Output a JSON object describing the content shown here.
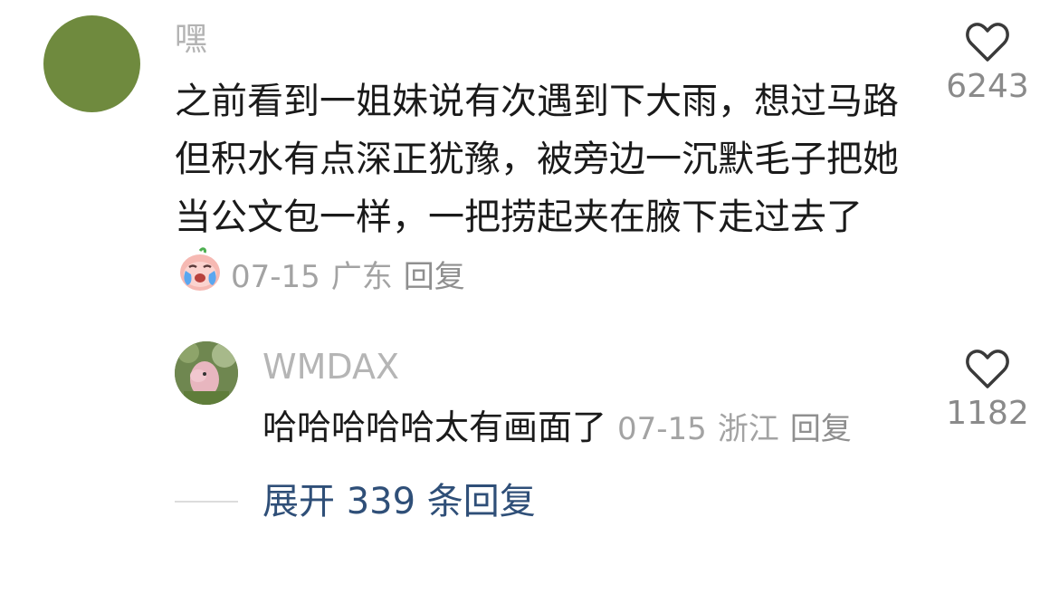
{
  "comment": {
    "author": "嘿",
    "text": "之前看到一姐妹说有次遇到下大雨，想过马路但积水有点深正犹豫，被旁边一沉默毛子把她当公文包一样，一把捞起夹在腋下走过去了",
    "emoji": "crying-face-emoji",
    "date": "07-15",
    "location": "广东",
    "reply_label": "回复",
    "likes": "6243",
    "avatar_color": "#6f8a3e"
  },
  "reply": {
    "author": "WMDAX",
    "text": "哈哈哈哈哈太有画面了",
    "date": "07-15",
    "location": "浙江",
    "reply_label": "回复",
    "likes": "1182"
  },
  "expand": {
    "label": "展开 339 条回复"
  },
  "colors": {
    "link": "#2f4f78",
    "meta": "#a3a3a3",
    "text": "#1a1a1a"
  }
}
